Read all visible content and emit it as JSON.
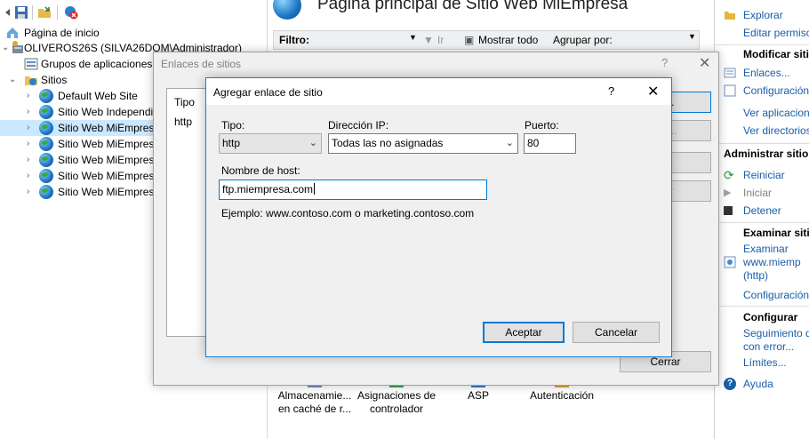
{
  "tree": {
    "items": [
      {
        "label": "Página de inicio"
      },
      {
        "label": "OLIVEROS26S (SILVA26DOM\\Administrador)"
      },
      {
        "label": "Grupos de aplicaciones"
      },
      {
        "label": "Sitios"
      },
      {
        "label": "Default Web Site"
      },
      {
        "label": "Sitio Web Independie"
      },
      {
        "label": "Sitio Web MiEmpresa"
      },
      {
        "label": "Sitio Web MiEmpresa"
      },
      {
        "label": "Sitio Web MiEmpresa"
      },
      {
        "label": "Sitio Web MiEmpresa"
      },
      {
        "label": "Sitio Web MiEmpresa"
      }
    ]
  },
  "main": {
    "title": "Página principal de Sitio Web MiEmpresa",
    "filter_label": "Filtro:",
    "go_label": "Ir",
    "show_all": "Mostrar todo",
    "group_by": "Agrupar por:",
    "features": [
      {
        "line1": "Almacenamie...",
        "line2": "en caché de r..."
      },
      {
        "line1": "Asignaciones de",
        "line2": "controlador"
      },
      {
        "line1": "ASP",
        "line2": ""
      },
      {
        "line1": "Autenticación",
        "line2": ""
      }
    ]
  },
  "actions": {
    "explorar": "Explorar",
    "editar_permisos": "Editar permiso",
    "modificar_header": "Modificar sitio",
    "enlaces": "Enlaces...",
    "configuracion": "Configuración",
    "ver_aplicaciones": "Ver aplicacione",
    "ver_directorios": "Ver directorios",
    "administrar_header": "Administrar sitio w",
    "reiniciar": "Reiniciar",
    "iniciar": "Iniciar",
    "detener": "Detener",
    "examinar_header": "Examinar sitio",
    "examinar_line1": "Examinar",
    "examinar_line2": "www.miemp",
    "examinar_line3": "(http)",
    "configuracion2": "Configuración",
    "configurar_header": "Configurar",
    "seguimiento1": "Seguimiento d",
    "seguimiento2": "con error...",
    "limites": "Límites...",
    "ayuda": "Ayuda"
  },
  "dialog_bindings": {
    "title": "Enlaces de sitios",
    "help": "?",
    "close": "✕",
    "col_tipo": "Tipo",
    "row_tipo": "http",
    "btn_agregar": "ar...",
    "btn_modificar": "car...",
    "btn_quitar": "ar",
    "btn_examinar": "nar",
    "btn_cerrar": "Cerrar"
  },
  "dialog_add": {
    "title": "Agregar enlace de sitio",
    "help": "?",
    "close": "✕",
    "tipo_label": "Tipo:",
    "tipo_value": "http",
    "ip_label": "Dirección IP:",
    "ip_value": "Todas las no asignadas",
    "puerto_label": "Puerto:",
    "puerto_value": "80",
    "host_label": "Nombre de host:",
    "host_value": "ftp.miempresa.com",
    "ejemplo": "Ejemplo: www.contoso.com o marketing.contoso.com",
    "aceptar": "Aceptar",
    "cancelar": "Cancelar"
  },
  "colors": {
    "accent": "#0078d7",
    "link": "#1a5ea8"
  }
}
